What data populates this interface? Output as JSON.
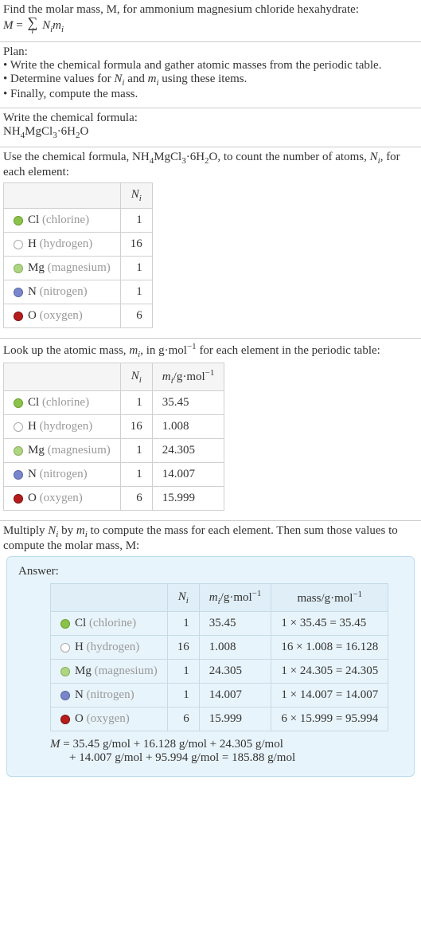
{
  "intro": {
    "line1": "Find the molar mass, M, for ammonium magnesium chloride hexahydrate:",
    "formula_lhs": "M = ",
    "formula_rhs": " N_i m_i",
    "sum_index": "i"
  },
  "plan": {
    "title": "Plan:",
    "b1": "• Write the chemical formula and gather atomic masses from the periodic table.",
    "b2_pre": "• Determine values for ",
    "b2_mid": " and ",
    "b2_post": " using these items.",
    "b2_Ni": "N_i",
    "b2_mi": "m_i",
    "b3": "• Finally, compute the mass."
  },
  "chemline": {
    "title": "Write the chemical formula:",
    "formula_html": "NH_4MgCl_3·6H_2O"
  },
  "count": {
    "intro_pre": "Use the chemical formula, ",
    "intro_formula": "NH_4MgCl_3·6H_2O",
    "intro_post_1": ", to count the number of atoms, ",
    "intro_Ni": "N_i",
    "intro_post_2": ", for each element:",
    "header_Ni": "N_i",
    "rows": [
      {
        "dot": "cl",
        "sym": "Cl",
        "name": "(chlorine)",
        "n": "1"
      },
      {
        "dot": "h",
        "sym": "H",
        "name": "(hydrogen)",
        "n": "16"
      },
      {
        "dot": "mg",
        "sym": "Mg",
        "name": "(magnesium)",
        "n": "1"
      },
      {
        "dot": "n",
        "sym": "N",
        "name": "(nitrogen)",
        "n": "1"
      },
      {
        "dot": "o",
        "sym": "O",
        "name": "(oxygen)",
        "n": "6"
      }
    ]
  },
  "mass": {
    "intro_pre": "Look up the atomic mass, ",
    "intro_mi": "m_i",
    "intro_mid": ", in g·mol",
    "intro_exp": "−1",
    "intro_post": " for each element in the periodic table:",
    "header_Ni": "N_i",
    "header_mi_pre": "m_i/g·mol",
    "header_mi_exp": "−1",
    "rows": [
      {
        "dot": "cl",
        "sym": "Cl",
        "name": "(chlorine)",
        "n": "1",
        "m": "35.45"
      },
      {
        "dot": "h",
        "sym": "H",
        "name": "(hydrogen)",
        "n": "16",
        "m": "1.008"
      },
      {
        "dot": "mg",
        "sym": "Mg",
        "name": "(magnesium)",
        "n": "1",
        "m": "24.305"
      },
      {
        "dot": "n",
        "sym": "N",
        "name": "(nitrogen)",
        "n": "1",
        "m": "14.007"
      },
      {
        "dot": "o",
        "sym": "O",
        "name": "(oxygen)",
        "n": "6",
        "m": "15.999"
      }
    ]
  },
  "answer": {
    "intro_pre": "Multiply ",
    "intro_Ni": "N_i",
    "intro_by": " by ",
    "intro_mi": "m_i",
    "intro_post": " to compute the mass for each element. Then sum those values to compute the molar mass, M:",
    "title": "Answer:",
    "header_Ni": "N_i",
    "header_mi_pre": "m_i/g·mol",
    "header_mi_exp": "−1",
    "header_mass_pre": "mass/g·mol",
    "header_mass_exp": "−1",
    "rows": [
      {
        "dot": "cl",
        "sym": "Cl",
        "name": "(chlorine)",
        "n": "1",
        "m": "35.45",
        "calc": "1 × 35.45 = 35.45"
      },
      {
        "dot": "h",
        "sym": "H",
        "name": "(hydrogen)",
        "n": "16",
        "m": "1.008",
        "calc": "16 × 1.008 = 16.128"
      },
      {
        "dot": "mg",
        "sym": "Mg",
        "name": "(magnesium)",
        "n": "1",
        "m": "24.305",
        "calc": "1 × 24.305 = 24.305"
      },
      {
        "dot": "n",
        "sym": "N",
        "name": "(nitrogen)",
        "n": "1",
        "m": "14.007",
        "calc": "1 × 14.007 = 14.007"
      },
      {
        "dot": "o",
        "sym": "O",
        "name": "(oxygen)",
        "n": "6",
        "m": "15.999",
        "calc": "6 × 15.999 = 95.994"
      }
    ],
    "final_l1": "M = 35.45 g/mol + 16.128 g/mol + 24.305 g/mol",
    "final_l2": "+ 14.007 g/mol + 95.994 g/mol = 185.88 g/mol"
  }
}
